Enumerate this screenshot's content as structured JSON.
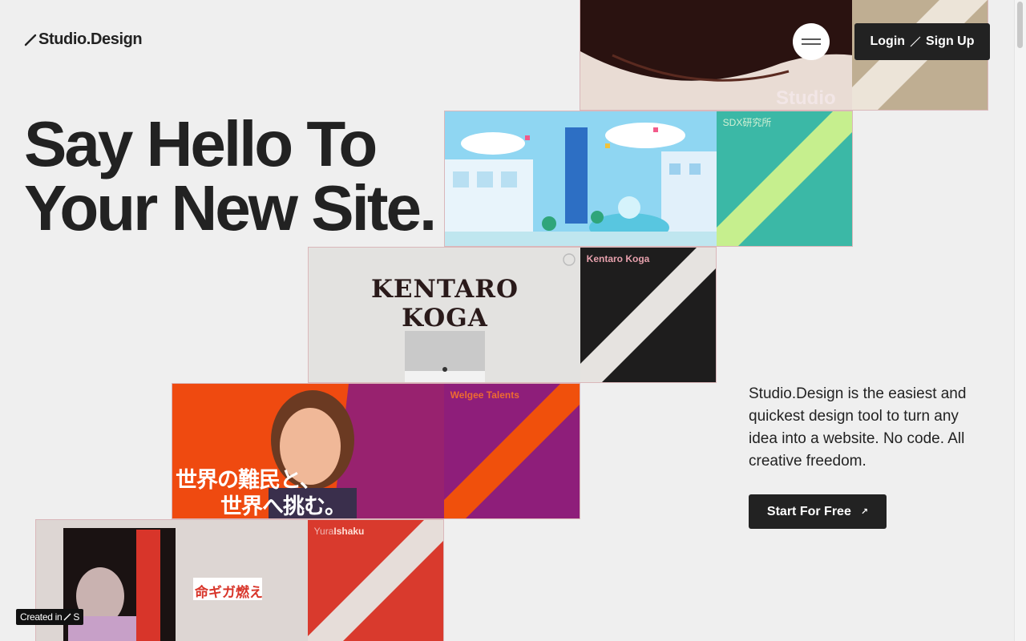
{
  "header": {
    "logo_text": "Studio.Design",
    "menu_icon": "hamburger-icon",
    "login_label": "Login",
    "signup_label": "Sign Up"
  },
  "hero": {
    "title_line1": "Say Hello To",
    "title_line2": "Your New Site.",
    "description": "Studio.Design is the easiest and quickest design tool to turn any idea into a website. No code. All creative freedom.",
    "cta_label": "Start For Free",
    "cta_icon": "arrow-up-right-icon"
  },
  "showcase": {
    "top": {
      "shot_text": "Studio"
    },
    "sdx": {
      "name": "SDX研究所",
      "stripe_color": "#c6ef8e",
      "tile_color": "#3bb8a6"
    },
    "koga": {
      "name": "Kentaro Koga",
      "shot_title_1": "KENTARO",
      "shot_title_2": "KOGA",
      "stripe_color": "#e6e3e0",
      "tile_color": "#1e1d1d"
    },
    "welgee": {
      "name": "Welgee Talents",
      "shot_jp_1": "世界の難民と、",
      "shot_jp_2": "世界へ挑む。",
      "stripe_color": "#f0500c",
      "tile_color": "#8e1e7a"
    },
    "yura": {
      "name_light": "Yura",
      "name_bold": "Ishaku",
      "shot_jp": "命ギガ燃え",
      "stripe_color": "#e6ddd9",
      "tile_color": "#d93a2d"
    }
  },
  "badge": {
    "text": "Created in"
  }
}
